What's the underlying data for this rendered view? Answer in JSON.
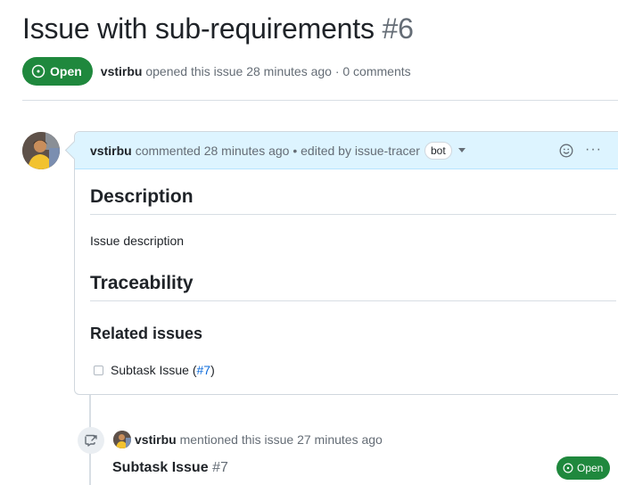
{
  "issue": {
    "title": "Issue with sub-requirements",
    "number": "#6",
    "state": "Open",
    "author": "vstirbu",
    "meta_text": "opened this issue 28 minutes ago · 0 comments"
  },
  "comment": {
    "author": "vstirbu",
    "header_text": "commented 28 minutes ago • edited by issue-tracer",
    "bot_label": "bot",
    "description_heading": "Description",
    "description_text": "Issue description",
    "traceability_heading": "Traceability",
    "related_heading": "Related issues",
    "task_item": {
      "label_prefix": "Subtask Issue (",
      "link": "#7",
      "label_suffix": ")",
      "checked": false
    }
  },
  "event": {
    "author": "vstirbu",
    "text": "mentioned this issue 27 minutes ago",
    "ref_title": "Subtask Issue",
    "ref_number": "#7",
    "ref_state": "Open"
  },
  "icons": {
    "state_icon": "issue-opened-icon",
    "reference_icon": "cross-reference-icon",
    "reaction_icon": "smiley-icon",
    "more_icon": "kebab-horizontal-icon"
  },
  "colors": {
    "open_green": "#1f883d",
    "link_blue": "#0969da",
    "header_bg": "#ddf4ff"
  }
}
